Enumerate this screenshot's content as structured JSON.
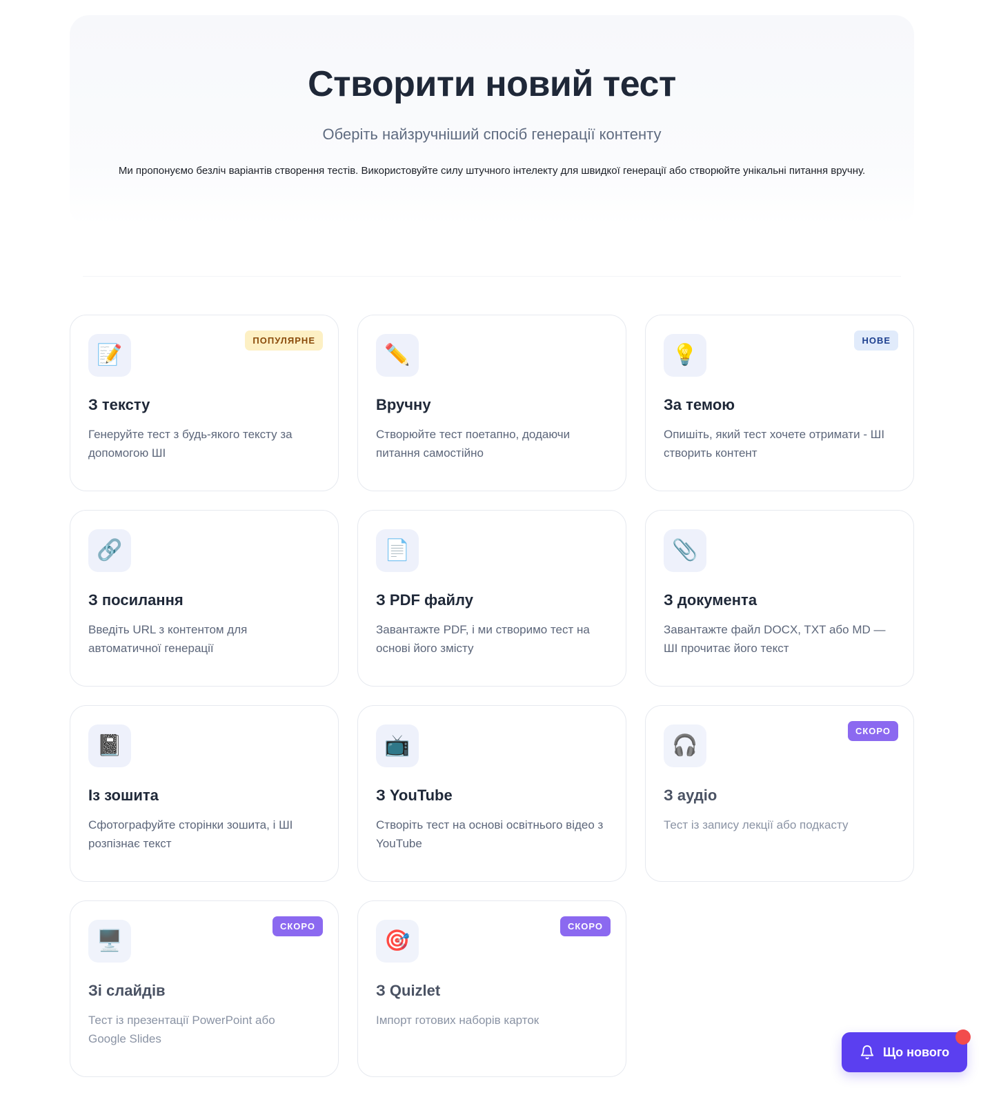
{
  "hero": {
    "title": "Створити новий тест",
    "subtitle": "Оберіть найзручніший спосіб генерації контенту",
    "description": "Ми пропонуємо безліч варіантів створення тестів. Використовуйте силу штучного інтелекту для швидкої генерації або створюйте унікальні питання вручну."
  },
  "cards": [
    {
      "icon": "📝",
      "icon_name": "memo-icon",
      "title": "З тексту",
      "description": "Генеруйте тест з будь-якого тексту за допомогою ШІ",
      "badge": "ПОПУЛЯРНЕ",
      "badge_type": "popular",
      "dim": false
    },
    {
      "icon": "✏️",
      "icon_name": "pencil-icon",
      "title": "Вручну",
      "description": "Створюйте тест поетапно, додаючи питання самостійно",
      "badge": "",
      "badge_type": "",
      "dim": false
    },
    {
      "icon": "💡",
      "icon_name": "lightbulb-icon",
      "title": "За темою",
      "description": "Опишіть, який тест хочете отримати - ШІ створить контент",
      "badge": "НОВЕ",
      "badge_type": "new",
      "dim": false
    },
    {
      "icon": "🔗",
      "icon_name": "link-icon",
      "title": "З посилання",
      "description": "Введіть URL з контентом для автоматичної генерації",
      "badge": "",
      "badge_type": "",
      "dim": false
    },
    {
      "icon": "📄",
      "icon_name": "document-icon",
      "title": "З PDF файлу",
      "description": "Завантажте PDF, і ми створимо тест на основі його змісту",
      "badge": "",
      "badge_type": "",
      "dim": false
    },
    {
      "icon": "📎",
      "icon_name": "paperclip-icon",
      "title": "З документа",
      "description": "Завантажте файл DOCX, TXT або MD — ШІ прочитає його текст",
      "badge": "",
      "badge_type": "",
      "dim": false
    },
    {
      "icon": "📓",
      "icon_name": "notebook-icon",
      "title": "Із зошита",
      "description": "Сфотографуйте сторінки зошита, і ШІ розпізнає текст",
      "badge": "",
      "badge_type": "",
      "dim": false
    },
    {
      "icon": "📺",
      "icon_name": "television-icon",
      "title": "З YouTube",
      "description": "Створіть тест на основі освітнього відео з YouTube",
      "badge": "",
      "badge_type": "",
      "dim": false
    },
    {
      "icon": "🎧",
      "icon_name": "headphones-icon",
      "title": "З аудіо",
      "description": "Тест із запису лекції або подкасту",
      "badge": "СКОРО",
      "badge_type": "soon",
      "dim": true
    },
    {
      "icon": "🖥️",
      "icon_name": "monitor-icon",
      "title": "Зі слайдів",
      "description": "Тест із презентації PowerPoint або Google Slides",
      "badge": "СКОРО",
      "badge_type": "soon",
      "dim": true
    },
    {
      "icon": "🎯",
      "icon_name": "target-icon",
      "title": "З Quizlet",
      "description": "Імпорт готових наборів карток",
      "badge": "СКОРО",
      "badge_type": "soon",
      "dim": true
    }
  ],
  "whats_new": {
    "label": "Що нового",
    "icon_name": "bell-icon"
  },
  "colors": {
    "accent": "#5b3ff0",
    "soon_badge": "#8b69f0",
    "popular_badge_bg": "#fdf0c4",
    "new_badge_bg": "#e1ebfb",
    "notification_dot": "#f24c4c"
  }
}
